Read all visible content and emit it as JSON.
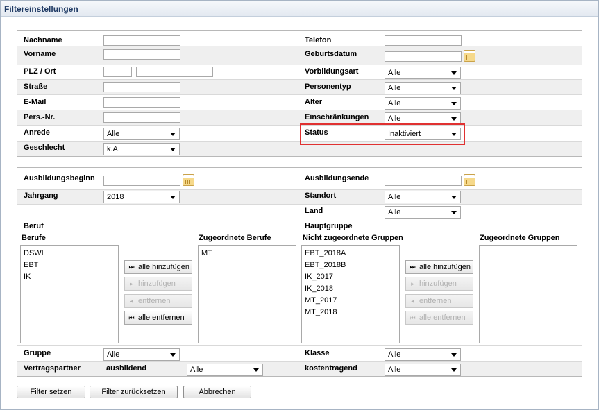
{
  "title": "Filtereinstellungen",
  "person": {
    "nachname": {
      "label": "Nachname",
      "value": ""
    },
    "vorname": {
      "label": "Vorname",
      "value": ""
    },
    "plz_ort": {
      "label": "PLZ / Ort",
      "plz": "",
      "ort": ""
    },
    "strasse": {
      "label": "Straße",
      "value": ""
    },
    "email": {
      "label": "E-Mail",
      "value": ""
    },
    "persnr": {
      "label": "Pers.-Nr.",
      "value": ""
    },
    "anrede": {
      "label": "Anrede",
      "value": "Alle"
    },
    "geschlecht": {
      "label": "Geschlecht",
      "value": "k.A."
    },
    "telefon": {
      "label": "Telefon",
      "value": ""
    },
    "geburtsdatum": {
      "label": "Geburtsdatum",
      "value": ""
    },
    "vorbildungsart": {
      "label": "Vorbildungsart",
      "value": "Alle"
    },
    "personentyp": {
      "label": "Personentyp",
      "value": "Alle"
    },
    "alter": {
      "label": "Alter",
      "value": "Alle"
    },
    "einschraenkungen": {
      "label": "Einschränkungen",
      "value": "Alle"
    },
    "status": {
      "label": "Status",
      "value": "Inaktiviert"
    }
  },
  "ausbildung": {
    "beginn": {
      "label": "Ausbildungsbeginn",
      "value": ""
    },
    "ende": {
      "label": "Ausbildungsende",
      "value": ""
    },
    "jahrgang": {
      "label": "Jahrgang",
      "value": "2018"
    },
    "standort": {
      "label": "Standort",
      "value": "Alle"
    },
    "land": {
      "label": "Land",
      "value": "Alle"
    },
    "beruf": {
      "heading": "Beruf",
      "list_label": "Berufe",
      "items": [
        "DSWI",
        "EBT",
        "IK"
      ],
      "assigned_label": "Zugeordnete Berufe",
      "assigned_items": [
        "MT"
      ]
    },
    "hauptgruppe": {
      "heading": "Hauptgruppe",
      "list_label": "Nicht zugeordnete Gruppen",
      "items": [
        "EBT_2018A",
        "EBT_2018B",
        "IK_2017",
        "IK_2018",
        "MT_2017",
        "MT_2018"
      ],
      "assigned_label": "Zugeordnete Gruppen",
      "assigned_items": []
    },
    "buttons": {
      "add_all": "alle hinzufügen",
      "add": "hinzufügen",
      "remove": "entfernen",
      "remove_all": "alle entfernen"
    },
    "gruppe": {
      "label": "Gruppe",
      "value": "Alle"
    },
    "klasse": {
      "label": "Klasse",
      "value": "Alle"
    },
    "vertragspartner": {
      "label": "Vertragspartner",
      "sub_label": "ausbildend",
      "value": "Alle"
    },
    "kostentragend": {
      "label": "kostentragend",
      "value": "Alle"
    }
  },
  "footer": {
    "filter_setzen": "Filter setzen",
    "filter_zuruecksetzen": "Filter zurücksetzen",
    "abbrechen": "Abbrechen"
  },
  "colors": {
    "highlight": "#e03131",
    "title": "#1f3a64",
    "band": "#efefef"
  }
}
